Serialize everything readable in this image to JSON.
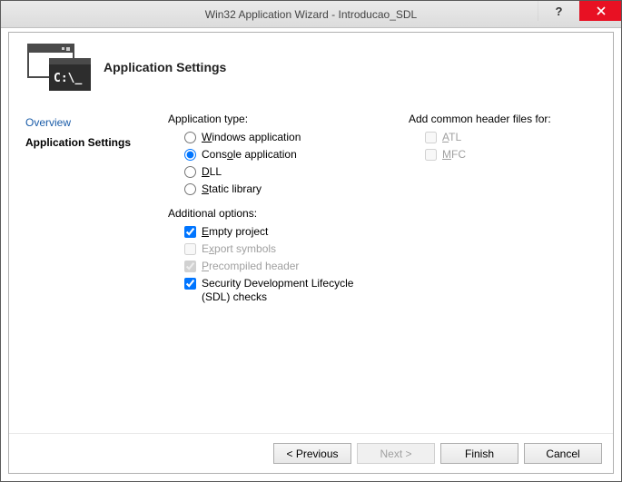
{
  "title": "Win32 Application Wizard - Introducao_SDL",
  "heading": "Application Settings",
  "sidebar": {
    "overview": "Overview",
    "appsettings": "Application Settings"
  },
  "apptype": {
    "label": "Application type:",
    "windows_pre": "W",
    "windows_rest": "indows application",
    "console_pre": "Cons",
    "console_u": "o",
    "console_rest": "le application",
    "dll_u": "D",
    "dll_rest": "LL",
    "static_u": "S",
    "static_rest": "tatic library"
  },
  "additional": {
    "label": "Additional options:",
    "empty_u": "E",
    "empty_rest": "mpty project",
    "export_pre": "E",
    "export_u": "x",
    "export_rest": "port symbols",
    "precomp_u": "P",
    "precomp_rest": "recompiled header",
    "sdl": "Security Development Lifecycle (SDL) checks"
  },
  "common": {
    "label": "Add common header files for:",
    "atl_u": "A",
    "atl_rest": "TL",
    "mfc_u": "M",
    "mfc_rest": "FC"
  },
  "buttons": {
    "prev": "< Previous",
    "next": "Next >",
    "finish": "Finish",
    "cancel": "Cancel"
  }
}
